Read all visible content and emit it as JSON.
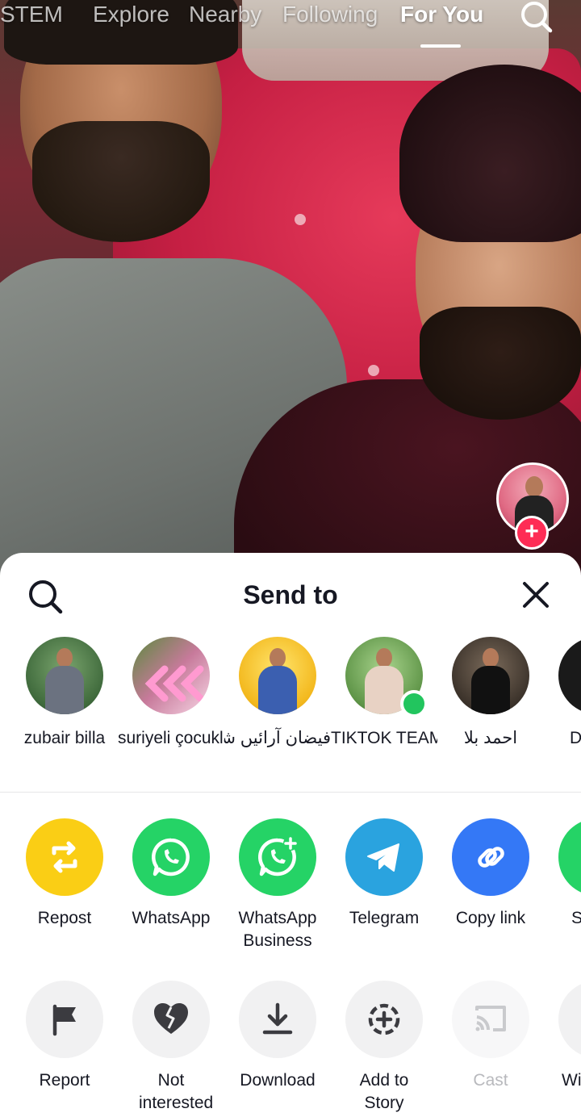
{
  "top_nav": {
    "tabs": [
      {
        "label": "STEM"
      },
      {
        "label": "Explore"
      },
      {
        "label": "Nearby"
      },
      {
        "label": "Following"
      },
      {
        "label": "For You"
      }
    ],
    "active_tab": "For You",
    "search_icon": "search-icon"
  },
  "creator": {
    "follow_icon": "plus-icon",
    "follow_symbol": "+"
  },
  "sheet": {
    "title": "Send to",
    "search_icon": "search-icon",
    "close_icon": "close-icon",
    "contacts": [
      {
        "name": "zubair billa"
      },
      {
        "name": "suriyeli çocuklar ..."
      },
      {
        "name": "فیضان آرائیں شاپور آلہ ..."
      },
      {
        "name": "TIKTOK TEAMWO..."
      },
      {
        "name": "احمد بلا"
      },
      {
        "name": "D"
      }
    ],
    "share_actions": [
      {
        "label": "Repost",
        "icon": "repost-icon",
        "color": "#FACE15"
      },
      {
        "label": "WhatsApp",
        "icon": "whatsapp-icon",
        "color": "#25D366"
      },
      {
        "label": "WhatsApp Business",
        "icon": "whatsapp-business-icon",
        "color": "#25D366"
      },
      {
        "label": "Telegram",
        "icon": "telegram-icon",
        "color": "#2AA3DF"
      },
      {
        "label": "Copy link",
        "icon": "link-icon",
        "color": "#3478F6"
      },
      {
        "label": "S",
        "icon": "whatsapp-status-icon",
        "color": "#25D366"
      }
    ],
    "more_actions": [
      {
        "label": "Report",
        "icon": "flag-icon"
      },
      {
        "label": "Not interested",
        "icon": "broken-heart-icon"
      },
      {
        "label": "Download",
        "icon": "download-icon"
      },
      {
        "label": "Add to Story",
        "icon": "add-story-icon"
      },
      {
        "label": "Cast",
        "icon": "cast-icon",
        "disabled": true
      },
      {
        "label": "Wi",
        "icon": "more-icon"
      }
    ]
  }
}
